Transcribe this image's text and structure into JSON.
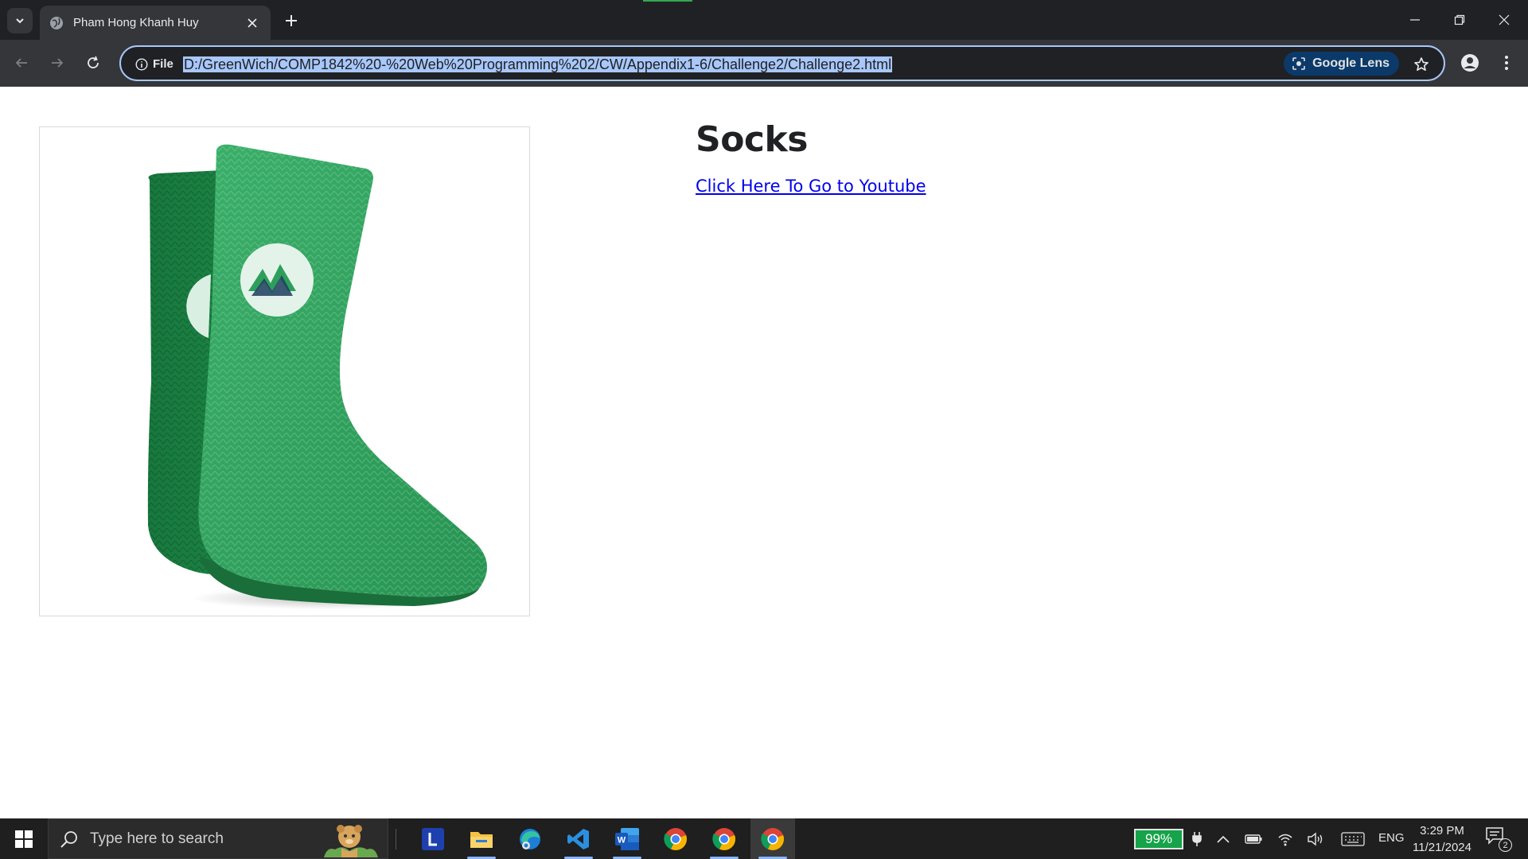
{
  "browser": {
    "tab_title": "Pham Hong Khanh Huy",
    "site_info_label": "File",
    "url": "D:/GreenWich/COMP1842%20-%20Web%20Programming%202/CW/Appendix1-6/Challenge2/Challenge2.html",
    "lens_label": "Google Lens"
  },
  "page": {
    "title": "Socks",
    "link_text": "Click Here To Go to Youtube"
  },
  "taskbar": {
    "search_placeholder": "Type here to search",
    "battery": "99%",
    "language": "ENG",
    "time": "3:29 PM",
    "date": "11/21/2024",
    "notification_count": "2",
    "apps": [
      "launcher-l-icon",
      "file-explorer-icon",
      "edge-icon",
      "vscode-icon",
      "word-icon",
      "chrome-icon",
      "chrome-icon",
      "chrome-icon"
    ]
  },
  "colors": {
    "accent": "#a8c7fa",
    "sock_green": "#2e9e5b",
    "link": "#0000ee"
  }
}
